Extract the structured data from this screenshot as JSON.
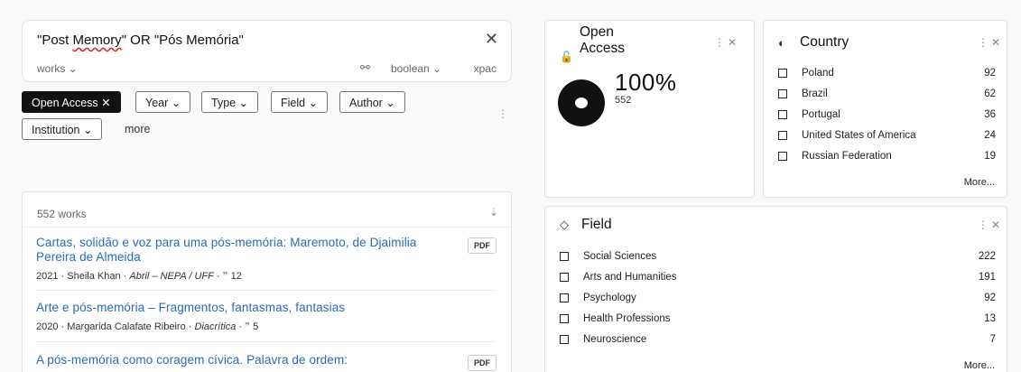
{
  "search": {
    "query_prefix": "\"Post ",
    "query_misspelled": "Memory",
    "query_suffix": "\" OR \"Pós Memória\"",
    "clear_label": "✕",
    "scope_label": "works ⌄",
    "tune_icon": "⚯",
    "mode_label": "boolean ⌄",
    "xpac_label": "xpac"
  },
  "filters": {
    "chips": [
      {
        "label": "Open Access ✕",
        "active": true
      },
      {
        "label": "Year ⌄"
      },
      {
        "label": "Type ⌄"
      },
      {
        "label": "Field ⌄"
      },
      {
        "label": "Author ⌄"
      },
      {
        "label": "Institution ⌄"
      }
    ],
    "more_label": "more",
    "kebab": "⋮"
  },
  "results": {
    "count_label": "552 works",
    "sort_icon": "⇣",
    "items": [
      {
        "title": "Cartas, solidão e voz para uma pós-memória: Maremoto, de Djaimilia Pereira de Almeida",
        "meta_prefix": "2021 · Sheila Khan · ",
        "venue": "Abril – NEPA / UFF",
        "meta_suffix": " · ",
        "cite_icon": "❞",
        "cites": " 12",
        "pdf_label": "PDF"
      },
      {
        "title": "Arte e pós-memória – Fragmentos, fantasmas, fantasias",
        "meta_prefix": "2020 · Margarida Calafate Ribeiro · ",
        "venue": "Diacrítica",
        "meta_suffix": " · ",
        "cite_icon": "❞",
        "cites": " 5"
      },
      {
        "title": "A pós-memória como coragem cívica. Palavra de ordem:",
        "pdf_label": "PDF"
      }
    ]
  },
  "open_access": {
    "title": "Open Access",
    "lock_icon": "🔓",
    "actions": "⋮✕",
    "percent_label": "100%",
    "percent_value": 100,
    "count": "552"
  },
  "country": {
    "title": "Country",
    "icon": "◐",
    "actions": "⋮✕",
    "rows": [
      {
        "label": "Poland",
        "count": "92"
      },
      {
        "label": "Brazil",
        "count": "62"
      },
      {
        "label": "Portugal",
        "count": "36"
      },
      {
        "label": "United States of America",
        "count": "24"
      },
      {
        "label": "Russian Federation",
        "count": "19"
      }
    ],
    "more_label": "More..."
  },
  "field": {
    "title": "Field",
    "icon": "◇",
    "actions": "⋮✕",
    "rows": [
      {
        "label": "Social Sciences",
        "count": "222"
      },
      {
        "label": "Arts and Humanities",
        "count": "191"
      },
      {
        "label": "Psychology",
        "count": "92"
      },
      {
        "label": "Health Professions",
        "count": "13"
      },
      {
        "label": "Neuroscience",
        "count": "7"
      }
    ],
    "more_label": "More..."
  }
}
